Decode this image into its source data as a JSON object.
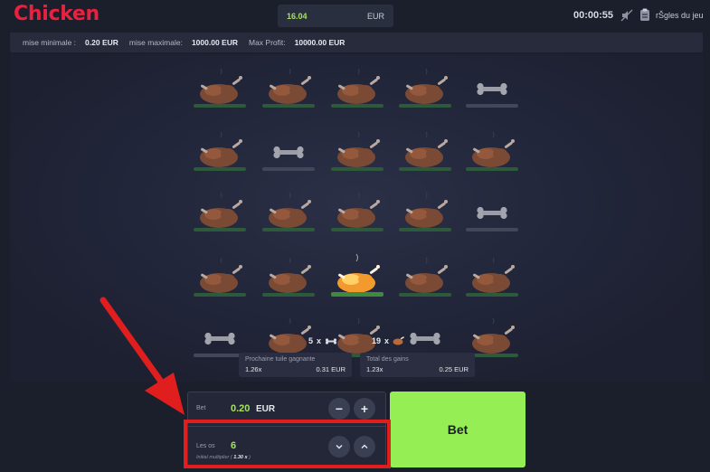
{
  "header": {
    "logo": "Chicken",
    "balance_amount": "16.04",
    "balance_currency": "EUR",
    "timer": "00:00:55",
    "rules_label": "rŠgles du jeu",
    "sound_icon": "sound-muted-icon",
    "rules_icon": "clipboard-icon"
  },
  "limits": {
    "min_label": "mise minimale :",
    "min_value": "0.20 EUR",
    "max_label": "mise maximale:",
    "max_value": "1000.00 EUR",
    "profit_label": "Max Profit:",
    "profit_value": "10000.00 EUR"
  },
  "board": {
    "rows": [
      [
        "chicken",
        "chicken",
        "chicken",
        "chicken",
        "bone"
      ],
      [
        "chicken",
        "bone",
        "chicken",
        "chicken",
        "chicken"
      ],
      [
        "chicken",
        "chicken",
        "chicken",
        "chicken",
        "bone"
      ],
      [
        "chicken",
        "chicken",
        "chicken-revealed",
        "chicken",
        "chicken"
      ],
      [
        "bone",
        "chicken",
        "chicken",
        "bone",
        "chicken"
      ]
    ],
    "bones_count": "5",
    "chickens_count": "19",
    "count_separator": "x"
  },
  "next_tile": {
    "title": "Prochaine tuile gagnante",
    "multiplier": "1.26x",
    "amount": "0.31 EUR"
  },
  "total_gains": {
    "title": "Total des gains",
    "multiplier": "1.23x",
    "amount": "0.25 EUR"
  },
  "bet_panel": {
    "bet_label": "Bet",
    "bet_amount": "0.20",
    "bet_currency": "EUR",
    "minus": "−",
    "plus": "+",
    "bones_label": "Les os",
    "bones_value": "6",
    "initial_multiplier_label": "Initial multiplier (",
    "initial_multiplier_value": "1.30 x",
    "initial_multiplier_close": ")",
    "bet_button": "Bet"
  },
  "colors": {
    "accent_green": "#96ee55",
    "value_green": "#a5e35b",
    "logo_red": "#e8213f",
    "annotation_red": "#e01e1e"
  }
}
